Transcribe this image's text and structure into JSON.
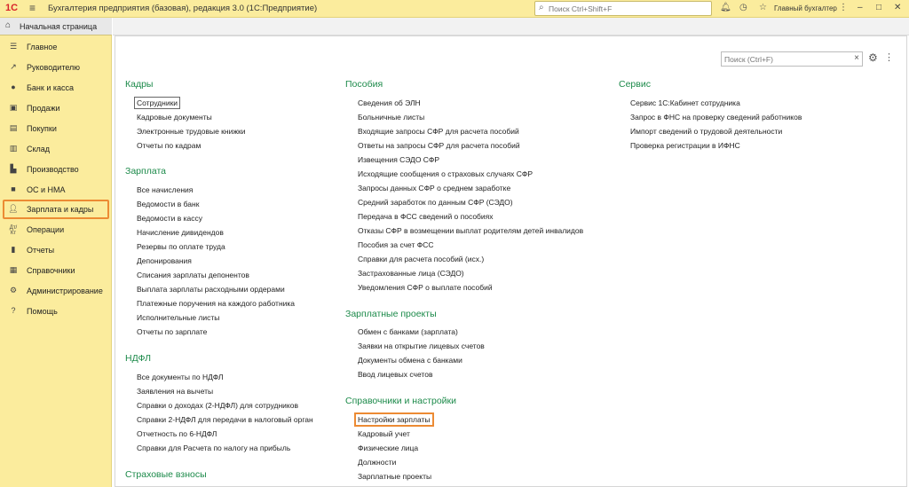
{
  "titlebar": {
    "logo": "1С",
    "app_title": "Бухгалтерия предприятия (базовая), редакция 3.0  (1С:Предприятие)",
    "search_placeholder": "Поиск Ctrl+Shift+F",
    "user": "Главный бухгалтер"
  },
  "home_tab": "Начальная страница",
  "sidebar": {
    "items": [
      {
        "label": "Главное",
        "icon": "menu-icon"
      },
      {
        "label": "Руководителю",
        "icon": "chart-trend-icon"
      },
      {
        "label": "Банк и касса",
        "icon": "coins-icon"
      },
      {
        "label": "Продажи",
        "icon": "bag-icon"
      },
      {
        "label": "Покупки",
        "icon": "basket-icon"
      },
      {
        "label": "Склад",
        "icon": "warehouse-icon"
      },
      {
        "label": "Производство",
        "icon": "factory-icon"
      },
      {
        "label": "ОС и НМА",
        "icon": "truck-icon"
      },
      {
        "label": "Зарплата и кадры",
        "icon": "person-icon"
      },
      {
        "label": "Операции",
        "icon": "dt-kt-icon"
      },
      {
        "label": "Отчеты",
        "icon": "bar-chart-icon"
      },
      {
        "label": "Справочники",
        "icon": "books-icon"
      },
      {
        "label": "Администрирование",
        "icon": "gear-icon"
      },
      {
        "label": "Помощь",
        "icon": "question-icon"
      }
    ],
    "active_index": 8
  },
  "local_search_placeholder": "Поиск (Ctrl+F)",
  "sections": {
    "kadry": {
      "title": "Кадры",
      "items": [
        "Сотрудники",
        "Кадровые документы",
        "Электронные трудовые книжки",
        "Отчеты по кадрам"
      ]
    },
    "zarplata": {
      "title": "Зарплата",
      "items": [
        "Все начисления",
        "Ведомости в банк",
        "Ведомости в кассу",
        "Начисление дивидендов",
        "Резервы по оплате труда",
        "Депонирования",
        "Списания зарплаты депонентов",
        "Выплата зарплаты расходными ордерами",
        "Платежные поручения на каждого работника",
        "Исполнительные листы",
        "Отчеты по зарплате"
      ]
    },
    "ndfl": {
      "title": "НДФЛ",
      "items": [
        "Все документы по НДФЛ",
        "Заявления на вычеты",
        "Справки о доходах (2-НДФЛ) для сотрудников",
        "Справки 2-НДФЛ для передачи в налоговый орган",
        "Отчетность по 6-НДФЛ",
        "Справки для Расчета по налогу на прибыль"
      ]
    },
    "strakhovye": {
      "title": "Страховые взносы"
    },
    "posobiya": {
      "title": "Пособия",
      "items": [
        "Сведения об ЭЛН",
        "Больничные листы",
        "Входящие запросы СФР для расчета пособий",
        "Ответы на запросы СФР для расчета пособий",
        "Извещения СЭДО СФР",
        "Исходящие сообщения о страховых случаях СФР",
        "Запросы данных СФР о среднем заработке",
        "Средний заработок по данным СФР (СЭДО)",
        "Передача в ФСС сведений о пособиях",
        "Отказы СФР в возмещении выплат родителям детей инвалидов",
        "Пособия за счет ФСС",
        "Справки для расчета пособий (исх.)",
        "Застрахованные лица (СЭДО)",
        "Уведомления СФР о выплате пособий"
      ]
    },
    "proekty": {
      "title": "Зарплатные проекты",
      "items": [
        "Обмен с банками (зарплата)",
        "Заявки на открытие лицевых счетов",
        "Документы обмена с банками",
        "Ввод лицевых счетов"
      ]
    },
    "spravochniki": {
      "title": "Справочники и настройки",
      "items": [
        "Настройки зарплаты",
        "Кадровый учет",
        "Физические лица",
        "Должности",
        "Зарплатные проекты"
      ]
    },
    "servis": {
      "title": "Сервис",
      "items": [
        "Сервис 1С:Кабинет сотрудника",
        "Запрос в ФНС на проверку сведений работников",
        "Импорт сведений о трудовой деятельности",
        "Проверка регистрации в ИФНС"
      ]
    }
  },
  "colors": {
    "titlebar_bg": "#fbec9d",
    "section_title": "#1c8a4a",
    "highlight": "#ec8b34"
  }
}
